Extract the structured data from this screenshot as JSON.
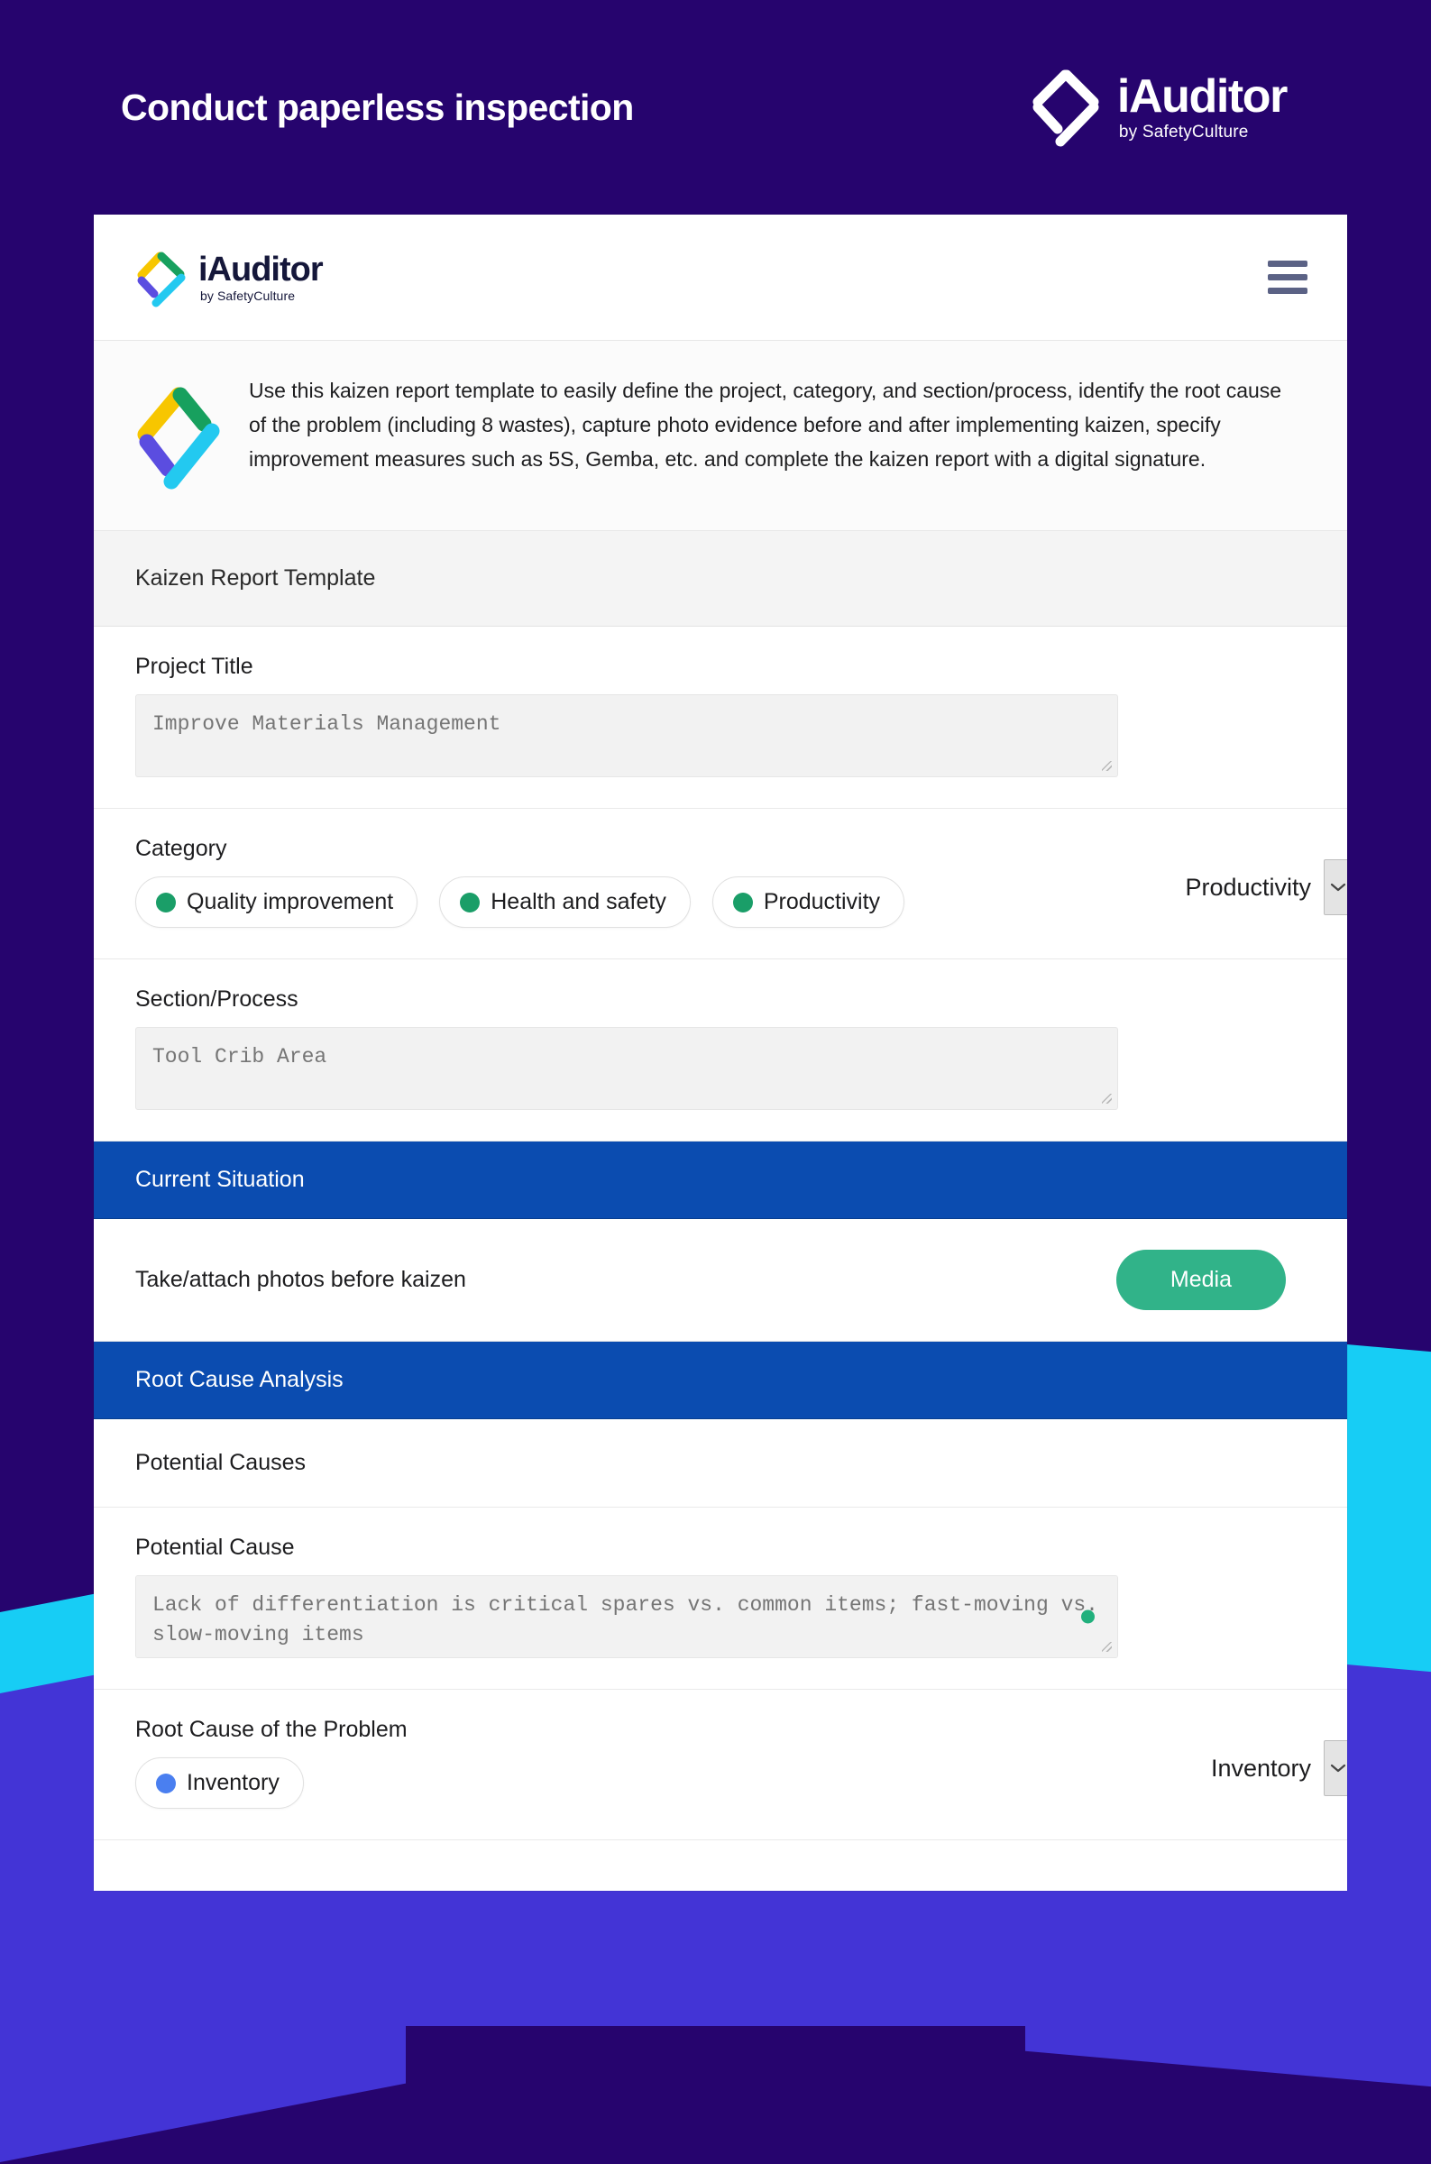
{
  "banner": {
    "title": "Conduct paperless inspection",
    "brand": "iAuditor",
    "brand_sub": "by SafetyCulture",
    "logo_icon": "iauditor-diamond-check-logo"
  },
  "app": {
    "brand": "iAuditor",
    "brand_sub": "by SafetyCulture",
    "logo_icon": "iauditor-diamond-check-logo",
    "menu_icon": "hamburger-menu-icon"
  },
  "intro": {
    "icon": "iauditor-diamond-check-logo",
    "text": "Use this kaizen report template to easily define the project, category, and section/process, identify the root cause of the problem (including 8 wastes), capture photo evidence before and after implementing kaizen, specify improvement measures such as 5S, Gemba, etc. and complete the kaizen report with a digital signature."
  },
  "template": {
    "title": "Kaizen Report Template"
  },
  "fields": {
    "project_title": {
      "label": "Project Title",
      "value": "Improve Materials Management",
      "placeholder": "Improve Materials Management"
    },
    "category": {
      "label": "Category",
      "options": [
        {
          "label": "Quality improvement",
          "dot": "green"
        },
        {
          "label": "Health and safety",
          "dot": "green"
        },
        {
          "label": "Productivity",
          "dot": "green"
        }
      ],
      "selected": "Productivity",
      "dropdown_icon": "chevron-down-icon"
    },
    "section_process": {
      "label": "Section/Process",
      "value": "Tool Crib Area",
      "placeholder": "Tool Crib Area"
    }
  },
  "sections": [
    {
      "id": "current-situation",
      "title": "Current Situation"
    },
    {
      "id": "root-cause-analysis",
      "title": "Root Cause Analysis"
    }
  ],
  "current_situation": {
    "item_label": "Take/attach photos before kaizen",
    "media_button": "Media"
  },
  "root_cause": {
    "potential_causes_label": "Potential Causes",
    "potential_cause_label": "Potential Cause",
    "potential_cause_value": "Lack of differentiation is critical spares vs. common items; fast-moving vs. slow-moving items",
    "root_cause_label": "Root Cause of the Problem",
    "root_cause_options": [
      {
        "label": "Inventory",
        "dot": "blue"
      }
    ],
    "root_cause_selected": "Inventory",
    "dropdown_icon": "chevron-down-icon"
  },
  "colors": {
    "banner_bg": "#26046e",
    "section_blue": "#0b4cb0",
    "media_green": "#31b389",
    "accent_cyan": "#17cdf5",
    "accent_purple": "#4334d6",
    "dot_green": "#1a9e68",
    "dot_blue": "#4a7ff0"
  }
}
